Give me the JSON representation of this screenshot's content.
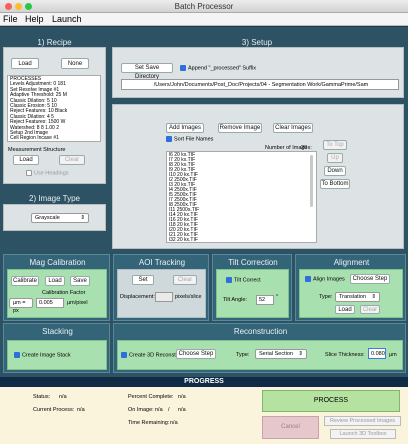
{
  "window": {
    "title": "Batch Processor"
  },
  "menu": [
    "File",
    "Help",
    "Launch"
  ],
  "recipe": {
    "header": "1) Recipe",
    "load": "Load",
    "none": "None",
    "lines": [
      "PROCESSES",
      "Levels Adjustment:  0  181",
      "Set Resolve Image #1",
      "Adaptive Threshold:  25  M",
      "Classic Dilation:  5  10",
      "Classic Erosion:  5  10",
      "Reject Features:  10  Black",
      "Classic Dilation:  4  5",
      "Reject Features:  1500  W",
      "Watershed:  8  8  1.00  2",
      "Setup 2nd Image",
      "Cell Region Incase #1"
    ],
    "measurement_label": "Measurement Structure",
    "m_load": "Load",
    "m_clear": "Clear",
    "use_headings": "Use Headings"
  },
  "image_type": {
    "header": "2) Image Type",
    "selected": "Grayscale"
  },
  "setup": {
    "header": "3) Setup",
    "set_save_dir": "Set Save Directory",
    "append_label": "Append \"_processed\" Suffix",
    "path": "/Users/John/Documents/Post_Doc/Projects/04 - Segmentation Work/GammaPrime/Sam",
    "add_images": "Add Images",
    "remove_image": "Remove Image",
    "clear_images": "Clear Images",
    "sort_label": "Sort File Names",
    "num_images_label": "Number of Images:",
    "num_images": "20",
    "files": [
      "l6 20 kx.TIF",
      "l7 20 kx.TIF",
      "l8 20 kx.TIF",
      "l9 20 kx.TIF",
      "l10 20 kx.TIF",
      "l2 2500x.TIF",
      "l3 20 kx.TIF",
      "l4 2500x.TIF",
      "l5 2500x.TIF",
      "l7 2500x.TIF",
      "l8 2500x.TIF",
      "l11 2500x.TIF",
      "l14 20 kx.TIF",
      "l16 20 kx.TIF",
      "l18 20 kx.TIF",
      "l20 20 kx.TIF",
      "l21 20 kx.TIF",
      "l32 20 kx.TIF"
    ],
    "to_top": "To Top",
    "up": "Up",
    "down": "Down",
    "to_bottom": "To Bottom"
  },
  "mag": {
    "title": "Mag Calibration",
    "calibrate": "Calibrate",
    "load": "Load",
    "save": "Save",
    "factor_label": "Calibration Factor",
    "prefix": "µm = px",
    "factor": "0.005",
    "unit": "µm/pixel"
  },
  "aoi": {
    "title": "AOI Tracking",
    "set": "Set",
    "clear": "Clear",
    "disp_label": "Displacement:",
    "disp_unit": "pixels/slice"
  },
  "tilt": {
    "title": "Tilt Correction",
    "tilt_correct": "Tilt Correct",
    "angle_label": "Tilt Angle:",
    "angle": "52",
    "deg": "°"
  },
  "align": {
    "title": "Alignment",
    "align_images": "Align Images",
    "choose_step": "Choose Step",
    "type_label": "Type:",
    "type": "Translation",
    "load": "Load",
    "clear": "Clear"
  },
  "stacking": {
    "title": "Stacking",
    "create_stack": "Create Image Stack"
  },
  "recon": {
    "title": "Reconstruction",
    "create_3d": "Create 3D Reconstruction",
    "choose_step": "Choose Step",
    "type_label": "Type:",
    "type": "Serial Section",
    "slice_label": "Slice Thickness:",
    "slice": "0.080",
    "slice_unit": "µm"
  },
  "progress": {
    "title": "PROGRESS",
    "status_label": "Status:",
    "status": "n/a",
    "current_label": "Current Process:",
    "current": "n/a",
    "percent_label": "Percent Complete:",
    "percent": "n/a",
    "on_image_label": "On Image:",
    "on_image": "n/a",
    "sep": "/",
    "of_image": "n/a",
    "time_label": "Time Remaining:",
    "time": "n/a",
    "process": "PROCESS",
    "cancel": "Cancel",
    "review": "Review Processed Images",
    "launch3d": "Launch 3D Toolbox"
  }
}
